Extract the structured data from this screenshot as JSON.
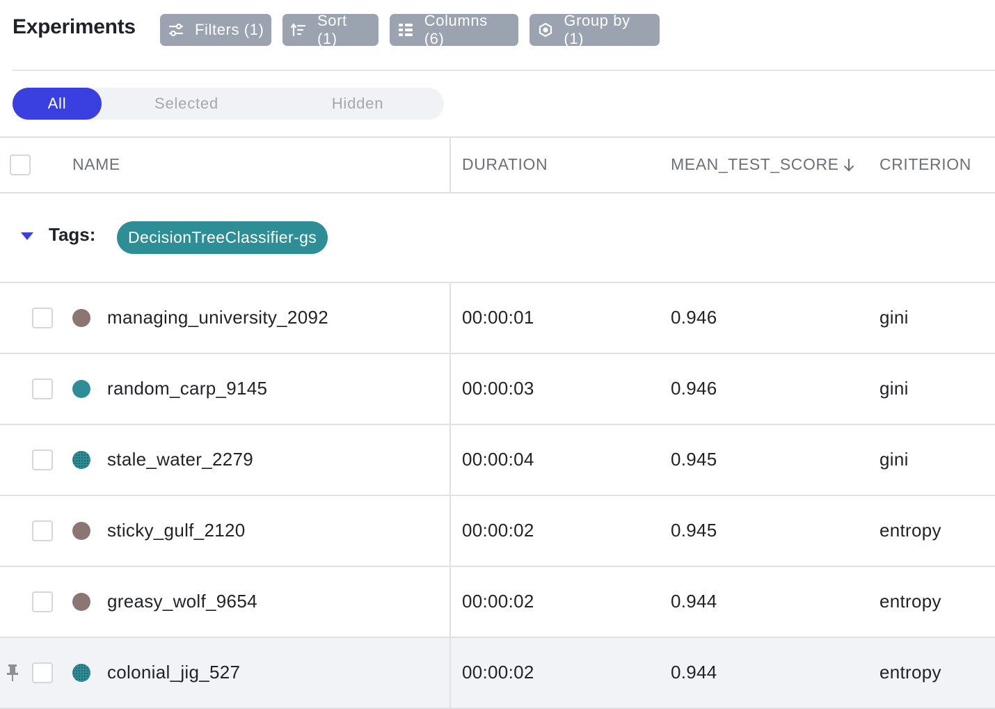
{
  "header": {
    "title": "Experiments",
    "buttons": [
      {
        "label": "Filters (1)",
        "icon": "filter-sliders-icon"
      },
      {
        "label": "Sort (1)",
        "icon": "sort-icon"
      },
      {
        "label": "Columns (6)",
        "icon": "columns-grid-icon"
      },
      {
        "label": "Group by (1)",
        "icon": "group-hexagon-icon"
      }
    ]
  },
  "view_tabs": {
    "items": [
      "All",
      "Selected",
      "Hidden"
    ],
    "active": "All"
  },
  "table": {
    "columns": {
      "name": "NAME",
      "duration": "DURATION",
      "mean_test_score": "MEAN_TEST_SCORE",
      "criterion": "CRITERION"
    },
    "sort": {
      "column": "MEAN_TEST_SCORE",
      "direction": "descending",
      "icon": "arrow-down-icon"
    },
    "group": {
      "label": "Tags:",
      "tag": "DecisionTreeClassifier-gs",
      "tag_color": "#2e8e96",
      "expanded": true
    },
    "rows": [
      {
        "name": "managing_university_2092",
        "duration": "00:00:01",
        "score": "0.946",
        "criterion": "gini",
        "color": "#8c7674",
        "textured": false,
        "pinned": false
      },
      {
        "name": "random_carp_9145",
        "duration": "00:00:03",
        "score": "0.946",
        "criterion": "gini",
        "color": "#2f8d98",
        "textured": false,
        "pinned": false
      },
      {
        "name": "stale_water_2279",
        "duration": "00:00:04",
        "score": "0.945",
        "criterion": "gini",
        "color": "#2f8d98",
        "textured": true,
        "pinned": false
      },
      {
        "name": "sticky_gulf_2120",
        "duration": "00:00:02",
        "score": "0.945",
        "criterion": "entropy",
        "color": "#8c7674",
        "textured": false,
        "pinned": false
      },
      {
        "name": "greasy_wolf_9654",
        "duration": "00:00:02",
        "score": "0.944",
        "criterion": "entropy",
        "color": "#8c7674",
        "textured": false,
        "pinned": false
      },
      {
        "name": "colonial_jig_527",
        "duration": "00:00:02",
        "score": "0.944",
        "criterion": "entropy",
        "color": "#2f8d98",
        "textured": true,
        "pinned": true
      }
    ]
  },
  "colors": {
    "accent": "#3a3fe0",
    "toolbar_button": "#9aa3af",
    "pinned_row_bg": "#f2f3f6"
  }
}
